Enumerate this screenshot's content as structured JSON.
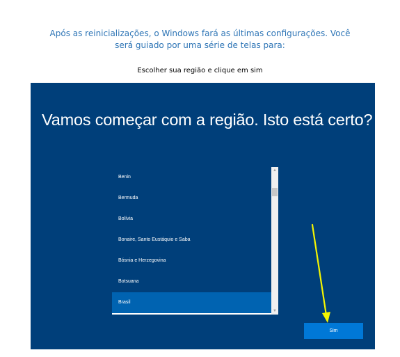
{
  "intro": {
    "line1": "Após as reinicializações, o Windows fará as últimas configurações. Você",
    "line2": "será guiado por uma série de telas para:"
  },
  "instruction": "Escolher sua região e clique em sim",
  "setup_screen": {
    "heading": "Vamos começar com a região. Isto está certo?",
    "regions": [
      "Benin",
      "Bermuda",
      "Bolívia",
      "Bonaire, Santo Eustáquio e Saba",
      "Bósnia e Herzegovina",
      "Botsuana",
      "Brasil"
    ],
    "selected_region": "Brasil",
    "yes_button": "Sim"
  },
  "icons": {
    "scroll_up": "scroll-up-arrow-icon",
    "scroll_down": "scroll-down-arrow-icon",
    "annotation": "yellow-pointer-arrow-icon"
  },
  "colors": {
    "background": "#003f7a",
    "selected": "#0063b1",
    "button": "#0078d7",
    "annotation": "#f5f500",
    "intro_text": "#2e75b6"
  }
}
